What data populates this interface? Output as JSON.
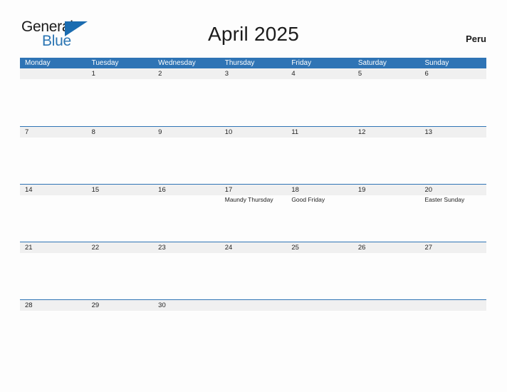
{
  "brand": {
    "name_part1": "General",
    "name_part2": "Blue",
    "accent_color": "#2b75b3"
  },
  "header": {
    "title": "April 2025",
    "country": "Peru"
  },
  "calendar": {
    "header_bg": "#2f74b5",
    "band_bg": "#f0f0f0",
    "weekdays": [
      "Monday",
      "Tuesday",
      "Wednesday",
      "Thursday",
      "Friday",
      "Saturday",
      "Sunday"
    ],
    "weeks": [
      [
        {
          "day": ""
        },
        {
          "day": "1"
        },
        {
          "day": "2"
        },
        {
          "day": "3"
        },
        {
          "day": "4"
        },
        {
          "day": "5"
        },
        {
          "day": "6"
        }
      ],
      [
        {
          "day": "7"
        },
        {
          "day": "8"
        },
        {
          "day": "9"
        },
        {
          "day": "10"
        },
        {
          "day": "11"
        },
        {
          "day": "12"
        },
        {
          "day": "13"
        }
      ],
      [
        {
          "day": "14"
        },
        {
          "day": "15"
        },
        {
          "day": "16"
        },
        {
          "day": "17",
          "event": "Maundy Thursday"
        },
        {
          "day": "18",
          "event": "Good Friday"
        },
        {
          "day": "19"
        },
        {
          "day": "20",
          "event": "Easter Sunday"
        }
      ],
      [
        {
          "day": "21"
        },
        {
          "day": "22"
        },
        {
          "day": "23"
        },
        {
          "day": "24"
        },
        {
          "day": "25"
        },
        {
          "day": "26"
        },
        {
          "day": "27"
        }
      ],
      [
        {
          "day": "28"
        },
        {
          "day": "29"
        },
        {
          "day": "30"
        },
        {
          "day": ""
        },
        {
          "day": ""
        },
        {
          "day": ""
        },
        {
          "day": ""
        }
      ]
    ]
  }
}
